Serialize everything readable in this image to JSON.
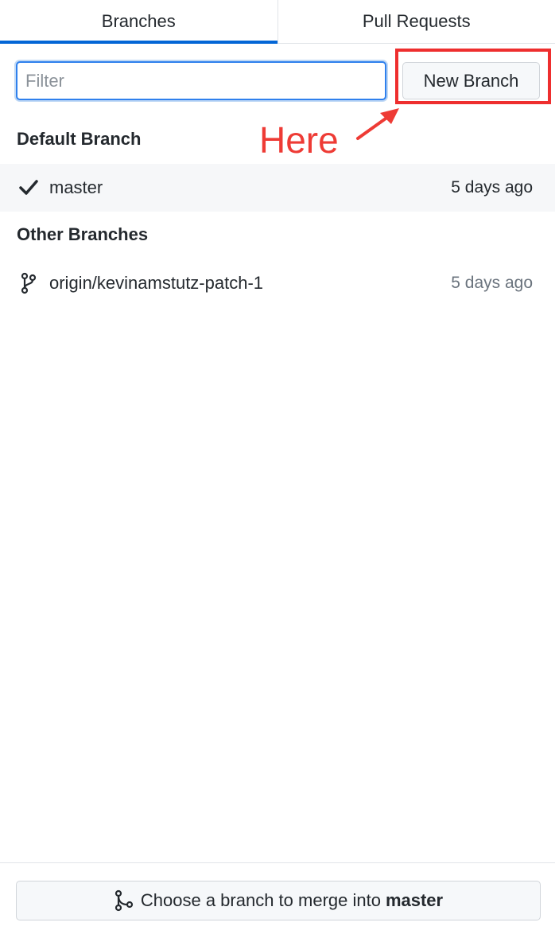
{
  "tabs": [
    {
      "label": "Branches",
      "active": true
    },
    {
      "label": "Pull Requests",
      "active": false
    }
  ],
  "filter": {
    "placeholder": "Filter",
    "value": ""
  },
  "new_branch_button": {
    "label": "New Branch"
  },
  "annotation": {
    "text": "Here",
    "color": "#ee3b35"
  },
  "sections": {
    "default": {
      "title": "Default Branch",
      "branches": [
        {
          "name": "master",
          "time": "5 days ago",
          "icon": "check-icon",
          "selected": true
        }
      ]
    },
    "other": {
      "title": "Other Branches",
      "branches": [
        {
          "name": "origin/kevinamstutz-patch-1",
          "time": "5 days ago",
          "icon": "git-branch-icon",
          "selected": false
        }
      ]
    }
  },
  "footer": {
    "merge_prefix": "Choose a branch to merge into",
    "merge_target": "master",
    "icon": "git-merge-icon"
  },
  "colors": {
    "accent": "#0366d6",
    "highlight": "#ee2e2e",
    "text": "#24292e",
    "muted": "#6a737d"
  }
}
